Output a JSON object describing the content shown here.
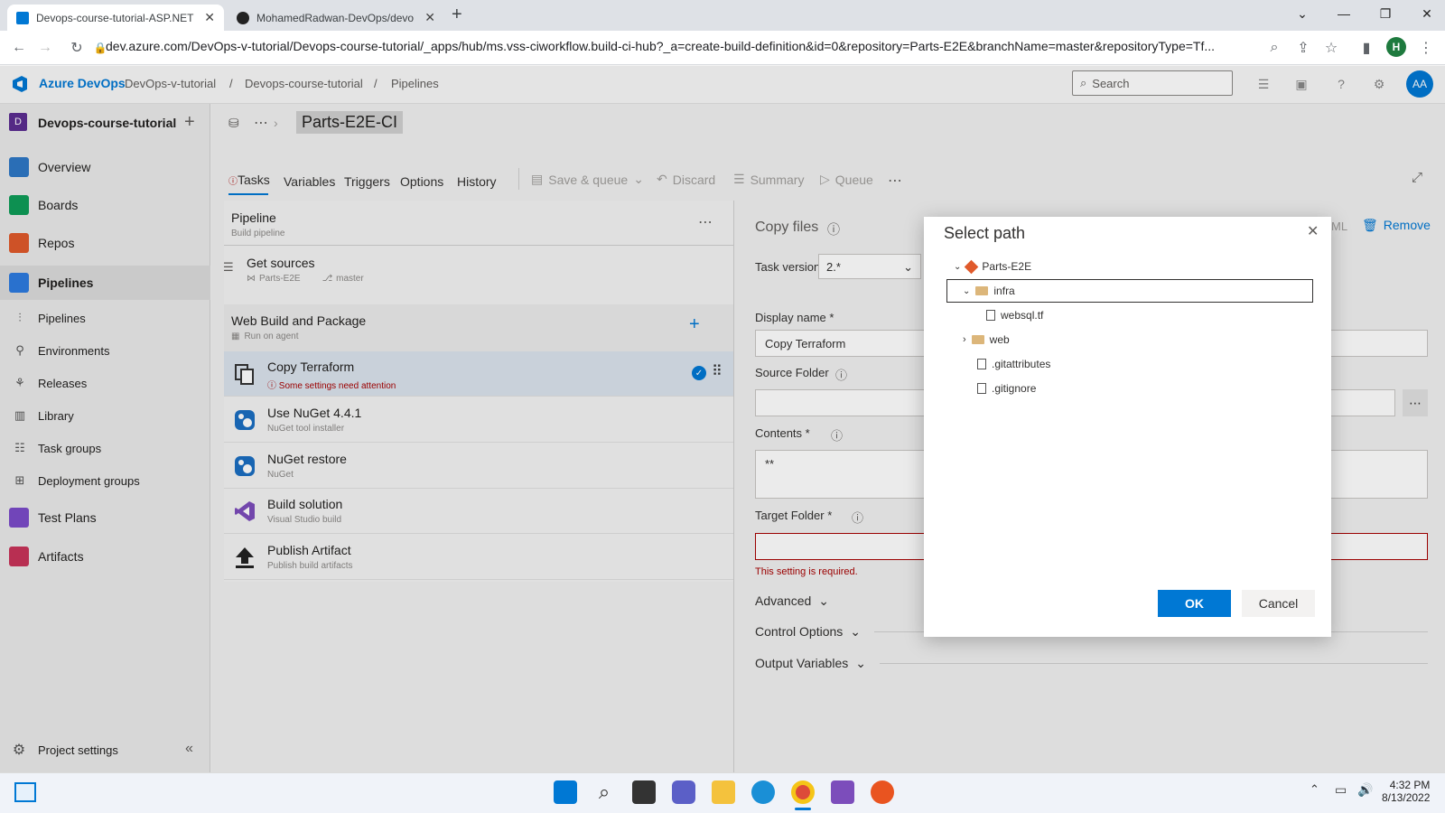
{
  "browser": {
    "tabs": [
      {
        "title": "Devops-course-tutorial-ASP.NET"
      },
      {
        "title": "MohamedRadwan-DevOps/devo"
      }
    ],
    "new_tab": "+",
    "url": "dev.azure.com/DevOps-v-tutorial/Devops-course-tutorial/_apps/hub/ms.vss-ciworkflow.build-ci-hub?_a=create-build-definition&id=0&repository=Parts-E2E&branchName=master&repositoryType=Tf...",
    "profile_initial": "H"
  },
  "header": {
    "brand": "Azure DevOps",
    "org": "DevOps-v-tutorial",
    "project": "Devops-course-tutorial",
    "section": "Pipelines",
    "search_placeholder": "Search",
    "user_initials": "AA"
  },
  "sidebar": {
    "project_initial": "D",
    "project_name": "Devops-course-tutorial",
    "items": [
      {
        "label": "Overview",
        "color": "#2e78c6"
      },
      {
        "label": "Boards",
        "color": "#0f9d58"
      },
      {
        "label": "Repos",
        "color": "#e05a2b"
      },
      {
        "label": "Pipelines",
        "color": "#2d7be0"
      },
      {
        "label": "Pipelines"
      },
      {
        "label": "Environments"
      },
      {
        "label": "Releases"
      },
      {
        "label": "Library"
      },
      {
        "label": "Task groups"
      },
      {
        "label": "Deployment groups"
      },
      {
        "label": "Test Plans",
        "color": "#7b4bc9"
      },
      {
        "label": "Artifacts",
        "color": "#c8345a"
      }
    ],
    "settings": "Project settings"
  },
  "pipeline": {
    "name": "Parts-E2E-CI",
    "tabs": [
      "Tasks",
      "Variables",
      "Triggers",
      "Options",
      "History"
    ],
    "toolbar": {
      "save": "Save & queue",
      "discard": "Discard",
      "summary": "Summary",
      "queue": "Queue"
    },
    "panel_title": "Pipeline",
    "panel_sub": "Build pipeline",
    "get_sources": "Get sources",
    "repo": "Parts-E2E",
    "branch": "master",
    "job_title": "Web Build and Package",
    "job_sub": "Run on agent",
    "tasks": [
      {
        "name": "Copy Terraform",
        "sub": "Some settings need attention"
      },
      {
        "name": "Use NuGet 4.4.1",
        "sub": "NuGet tool installer"
      },
      {
        "name": "NuGet restore",
        "sub": "NuGet"
      },
      {
        "name": "Build solution",
        "sub": "Visual Studio build"
      },
      {
        "name": "Publish Artifact",
        "sub": "Publish build artifacts"
      }
    ]
  },
  "task_detail": {
    "title": "Copy files",
    "version_label": "Task version",
    "version_value": "2.*",
    "yaml": "ML",
    "remove": "Remove",
    "display_name_label": "Display name *",
    "display_name_value": "Copy Terraform",
    "source_folder_label": "Source Folder",
    "contents_label": "Contents *",
    "contents_value": "**",
    "target_folder_label": "Target Folder *",
    "required_msg": "This setting is required.",
    "advanced": "Advanced",
    "control_options": "Control Options",
    "output_variables": "Output Variables"
  },
  "dialog": {
    "title": "Select path",
    "tree": [
      {
        "label": "Parts-E2E"
      },
      {
        "label": "infra"
      },
      {
        "label": "websql.tf"
      },
      {
        "label": "web"
      },
      {
        "label": ".gitattributes"
      },
      {
        "label": ".gitignore"
      }
    ],
    "ok": "OK",
    "cancel": "Cancel"
  },
  "taskbar": {
    "time": "4:32 PM",
    "date": "8/13/2022"
  }
}
